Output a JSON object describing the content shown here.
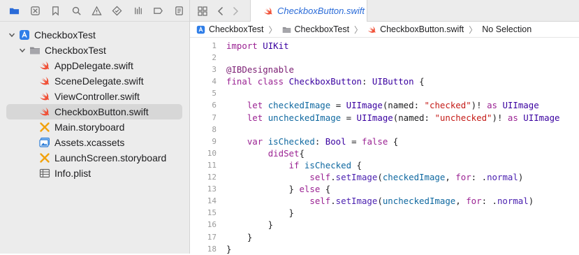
{
  "navigator": {
    "toolbar_icons": [
      "folder-icon",
      "source-control-icon",
      "bookmark-icon",
      "find-icon",
      "issue-icon",
      "test-icon",
      "debug-icon",
      "breakpoint-icon",
      "report-icon"
    ],
    "tree": [
      {
        "label": "CheckboxTest",
        "kind": "project",
        "level": 0,
        "expanded": true
      },
      {
        "label": "CheckboxTest",
        "kind": "group",
        "level": 1,
        "expanded": true
      },
      {
        "label": "AppDelegate.swift",
        "kind": "swift",
        "level": 2
      },
      {
        "label": "SceneDelegate.swift",
        "kind": "swift",
        "level": 2
      },
      {
        "label": "ViewController.swift",
        "kind": "swift",
        "level": 2
      },
      {
        "label": "CheckboxButton.swift",
        "kind": "swift",
        "level": 2,
        "selected": true
      },
      {
        "label": "Main.storyboard",
        "kind": "storyboard",
        "level": 2
      },
      {
        "label": "Assets.xcassets",
        "kind": "assets",
        "level": 2
      },
      {
        "label": "LaunchScreen.storyboard",
        "kind": "storyboard",
        "level": 2
      },
      {
        "label": "Info.plist",
        "kind": "plist",
        "level": 2
      }
    ]
  },
  "editor": {
    "active_tab": "CheckboxButton.swift",
    "breadcrumb": [
      "CheckboxTest",
      "CheckboxTest",
      "CheckboxButton.swift",
      "No Selection"
    ],
    "line_numbers": [
      "1",
      "2",
      "3",
      "4",
      "5",
      "6",
      "7",
      "8",
      "9",
      "10",
      "11",
      "12",
      "13",
      "14",
      "15",
      "16",
      "17",
      "18"
    ],
    "code_lines": [
      "import UIKit",
      "",
      "@IBDesignable",
      "final class CheckboxButton: UIButton {",
      "",
      "    let checkedImage = UIImage(named: \"checked\")! as UIImage",
      "    let uncheckedImage = UIImage(named: \"unchecked\")! as UIImage",
      "",
      "    var isChecked: Bool = false {",
      "        didSet{",
      "            if isChecked {",
      "                self.setImage(checkedImage, for: .normal)",
      "            } else {",
      "                self.setImage(uncheckedImage, for: .normal)",
      "            }",
      "        }",
      "    }",
      "}"
    ]
  },
  "colors": {
    "swift_icon": "#f05138",
    "accent": "#2a6bd8",
    "keyword": "#9b2393",
    "string": "#c41a16"
  }
}
